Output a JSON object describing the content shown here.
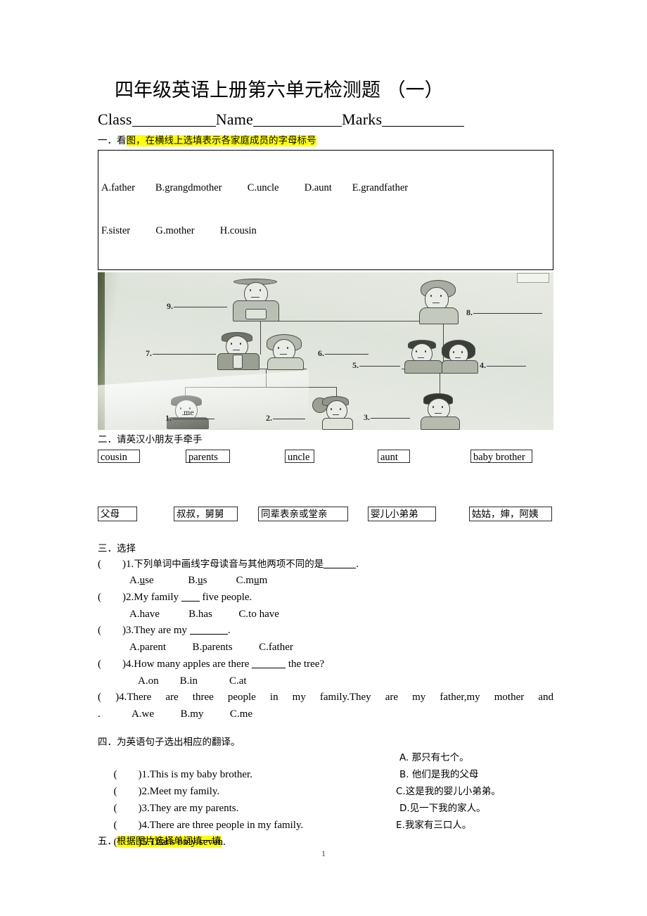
{
  "document": {
    "title": "四年级英语上册第六单元检测题 （一）",
    "page_number": "1"
  },
  "id_line": {
    "class_label": "Class",
    "name_label": "Name",
    "marks_label": "Marks"
  },
  "section1": {
    "number": "一．",
    "prefix": "看",
    "heading_highlighted": "图，在横线上选填表示各家庭成员的字母标号",
    "options_line1": "A.father        B.grangdmother          C.uncle          D.aunt        E.grandfather",
    "options_line2": "F.sister          G.mother          H.cousin",
    "image": {
      "caption_me": "me",
      "blanks": [
        "1.",
        "2.",
        "3.",
        "4.",
        "5.",
        "6.",
        "7.",
        "8.",
        "9."
      ]
    }
  },
  "section2": {
    "heading": "二．请英汉小朋友手牵手",
    "english_words": [
      "cousin",
      "parents",
      "uncle",
      "aunt",
      "baby brother"
    ],
    "chinese_words": [
      "父母",
      "叔叔，舅舅",
      "同辈表亲或堂亲",
      "婴儿小弟弟",
      "姑姑，婶，阿姨"
    ]
  },
  "section3": {
    "heading": "三．选择",
    "questions": [
      {
        "bracket": "(        )",
        "number": "1.",
        "stem_cn": "下列单词中画线字母读音与其他两项不同的是",
        "tail": ".",
        "choices": "A.use             B.us           C.mum",
        "choice_a": "A.",
        "choice_a_pre": "",
        "choice_a_u": "u",
        "choice_a_post": "se",
        "choice_b_pre": "B.",
        "choice_b_u": "u",
        "choice_b_post": "s",
        "choice_c_pre": "C.m",
        "choice_c_u": "u",
        "choice_c_post": "m"
      },
      {
        "bracket": "(        )",
        "number": "2.",
        "stem": "My family ___ five people.",
        "stem_pre": "My family ",
        "stem_post": " five people.",
        "choices": "A.have           B.has          C.to have"
      },
      {
        "bracket": "(        )",
        "number": "3.",
        "stem_pre": "They are my ",
        "stem_post": ".",
        "choices": "A.parent          B.parents          C.father"
      },
      {
        "bracket": "(        )",
        "number": "4.",
        "stem_pre": "How many apples are there ",
        "stem_post": " the tree?",
        "choices": "A.on        B.in            C.at"
      },
      {
        "bracket": "(        )",
        "number": "4.",
        "stem_justified": "There are three people in my family.They are my father,my mother and",
        "stem_tail": ".",
        "choices": "A.we          B.my          C.me"
      }
    ]
  },
  "section4": {
    "heading": "四．为英语句子选出相应的翻译。",
    "left_items": [
      "(        )1.This is my baby brother.",
      "(        )2.Meet my family.",
      "(        )3.They are my parents.",
      "(        )4.There are three people in my family.",
      "(        )5.That's only seven."
    ],
    "right_items": [
      "A. 那只有七个。",
      "B. 他们是我的父母",
      "C.这是我的婴儿小弟弟。",
      "D.见一下我的家人。",
      "E.我家有三口人。"
    ]
  },
  "section5": {
    "number": "五．",
    "heading_highlighted": "根据图片选择单词填一填"
  },
  "colors": {
    "highlight": "#ffff00",
    "text": "#000000",
    "photo_paper": "#e5e9e0"
  }
}
